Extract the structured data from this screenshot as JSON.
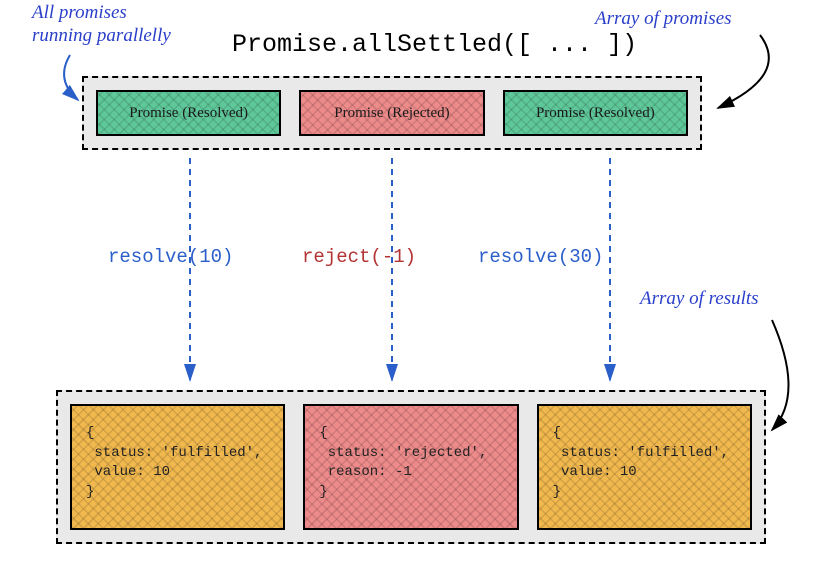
{
  "annotations": {
    "parallel": "All promises\nrunning parallelly",
    "arrayPromises": "Array of promises",
    "arrayResults": "Array of results"
  },
  "title": "Promise.allSettled([ ... ])",
  "promises": [
    {
      "label": "Promise (Resolved)",
      "status": "resolved"
    },
    {
      "label": "Promise (Rejected)",
      "status": "rejected"
    },
    {
      "label": "Promise (Resolved)",
      "status": "resolved"
    }
  ],
  "actions": [
    {
      "label": "resolve(10)",
      "color": "blue"
    },
    {
      "label": "reject(-1)",
      "color": "red"
    },
    {
      "label": "resolve(30)",
      "color": "blue"
    }
  ],
  "results": [
    {
      "text": "{\n status: 'fulfilled',\n value: 10\n}",
      "status": "fulfilled"
    },
    {
      "text": "{\n status: 'rejected',\n reason: -1\n}",
      "status": "rejected"
    },
    {
      "text": "{\n status: 'fulfilled',\n value: 10\n}",
      "status": "fulfilled"
    }
  ],
  "chart_data": {
    "type": "table",
    "title": "Promise.allSettled behavior",
    "inputs": [
      {
        "promise": 1,
        "outcome": "resolve",
        "value": 10
      },
      {
        "promise": 2,
        "outcome": "reject",
        "value": -1
      },
      {
        "promise": 3,
        "outcome": "resolve",
        "value": 30
      }
    ],
    "outputs": [
      {
        "status": "fulfilled",
        "value": 10
      },
      {
        "status": "rejected",
        "reason": -1
      },
      {
        "status": "fulfilled",
        "value": 10
      }
    ]
  },
  "colors": {
    "resolved": "#5fc89a",
    "rejected": "#ed8a8a",
    "fulfilledResult": "#f1b84e",
    "annotation": "#2a3fc9"
  }
}
